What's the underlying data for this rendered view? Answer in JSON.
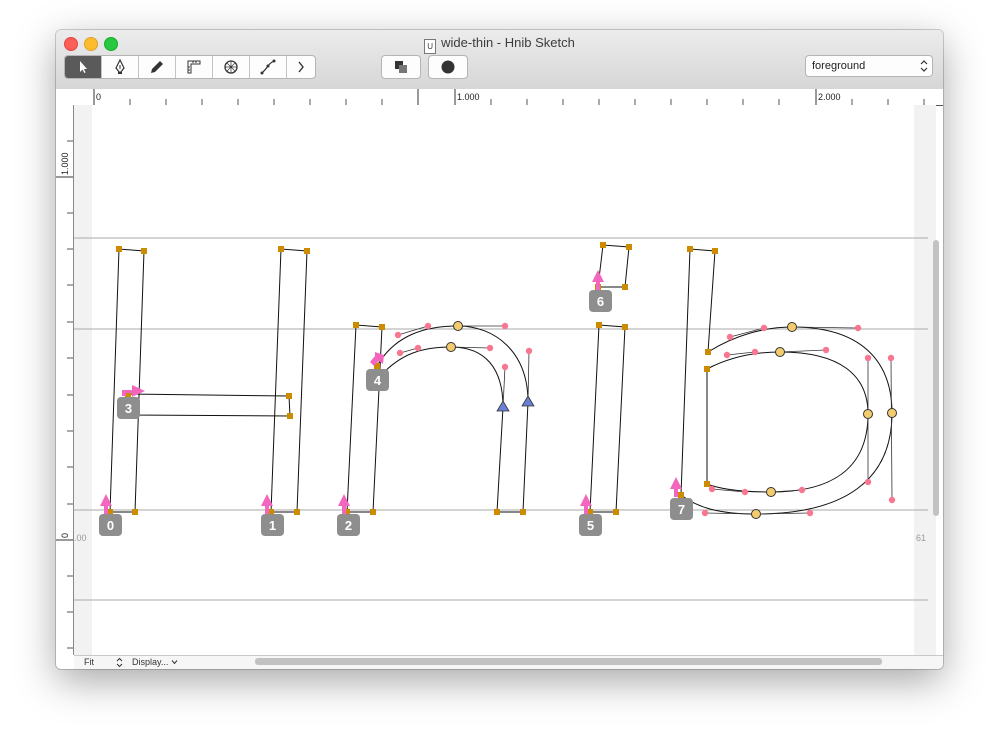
{
  "window": {
    "title": "wide-thin - Hnib Sketch",
    "doc_icon": "U"
  },
  "toolbar": {
    "tools": [
      {
        "name": "pointer-tool-icon",
        "active": true
      },
      {
        "name": "pen-tool-icon",
        "active": false
      },
      {
        "name": "pencil-tool-icon",
        "active": false
      },
      {
        "name": "ruler-tool-icon",
        "active": false
      },
      {
        "name": "shape-tool-icon",
        "active": false
      },
      {
        "name": "knife-tool-icon",
        "active": false
      },
      {
        "name": "more-chevron-icon",
        "active": false
      }
    ],
    "layer_value": "foreground"
  },
  "ruler": {
    "h_labels": [
      "0",
      "1.000",
      "2.000"
    ],
    "v_labels": [
      "1.000",
      "0"
    ]
  },
  "canvas": {
    "left_metric": ".00",
    "right_metric": "61",
    "glyph_numbers": [
      "0",
      "1",
      "2",
      "3",
      "4",
      "5",
      "6",
      "7"
    ]
  },
  "bottom": {
    "zoom": "Fit",
    "display": "Display..."
  },
  "colors": {
    "on_curve_square": "#cc8b00",
    "off_curve_point": "#f77790",
    "smooth_point": "#f4cc6e",
    "tangent_point": "#6a7fd6",
    "start_arrow": "#f266be",
    "label_bg": "#8e8e8e"
  }
}
